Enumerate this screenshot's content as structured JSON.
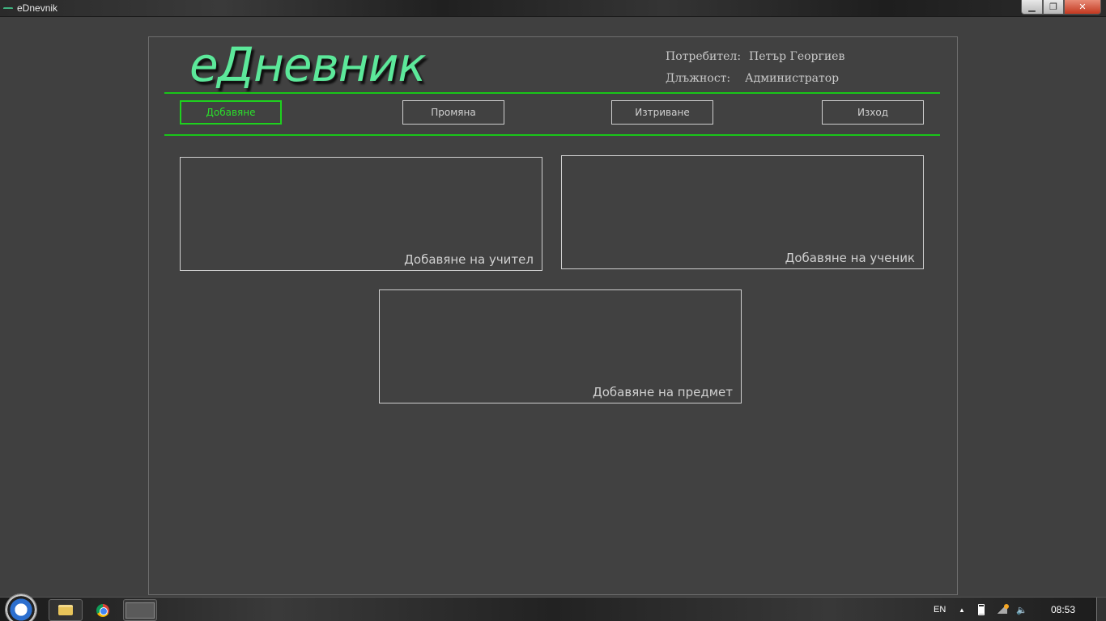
{
  "window": {
    "title": "eDnevnik",
    "minimize_glyph": "▁",
    "maximize_glyph": "❐",
    "close_glyph": "✕"
  },
  "header": {
    "logo": "еДневник",
    "user_label": "Потребител:",
    "user_value": "Петър Георгиев",
    "role_label": "Длъжност:",
    "role_value": "Администратор"
  },
  "nav": {
    "add": "Добавяне",
    "edit": "Промяна",
    "delete": "Изтриване",
    "exit": "Изход"
  },
  "tiles": {
    "teacher": "Добавяне на учител",
    "student": "Добавяне на ученик",
    "subject": "Добавяне на предмет"
  },
  "taskbar": {
    "language": "EN",
    "clock": "08:53",
    "tray_arrow": "▲",
    "volume_glyph": "🔈"
  },
  "colors": {
    "background": "#404040",
    "accent_green": "#19c619",
    "logo_green": "#5ce89a",
    "text": "#d0d0d0"
  }
}
